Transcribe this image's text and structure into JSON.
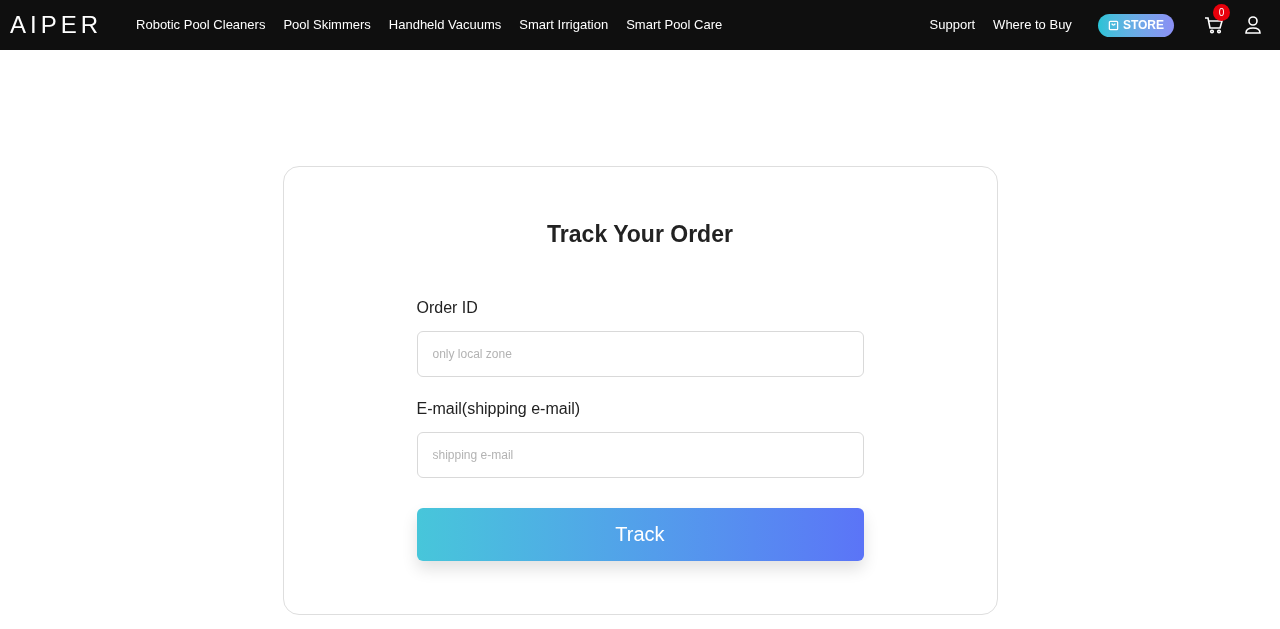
{
  "header": {
    "logo": "AIPER",
    "nav": [
      "Robotic Pool Cleaners",
      "Pool Skimmers",
      "Handheld Vacuums",
      "Smart Irrigation",
      "Smart Pool Care"
    ],
    "links": [
      "Support",
      "Where to Buy"
    ],
    "store_button": "STORE",
    "cart_count": "0"
  },
  "form": {
    "title": "Track Your Order",
    "fields": [
      {
        "label": "Order ID",
        "placeholder": "only local zone"
      },
      {
        "label": "E-mail(shipping e-mail)",
        "placeholder": "shipping e-mail"
      }
    ],
    "submit": "Track"
  }
}
